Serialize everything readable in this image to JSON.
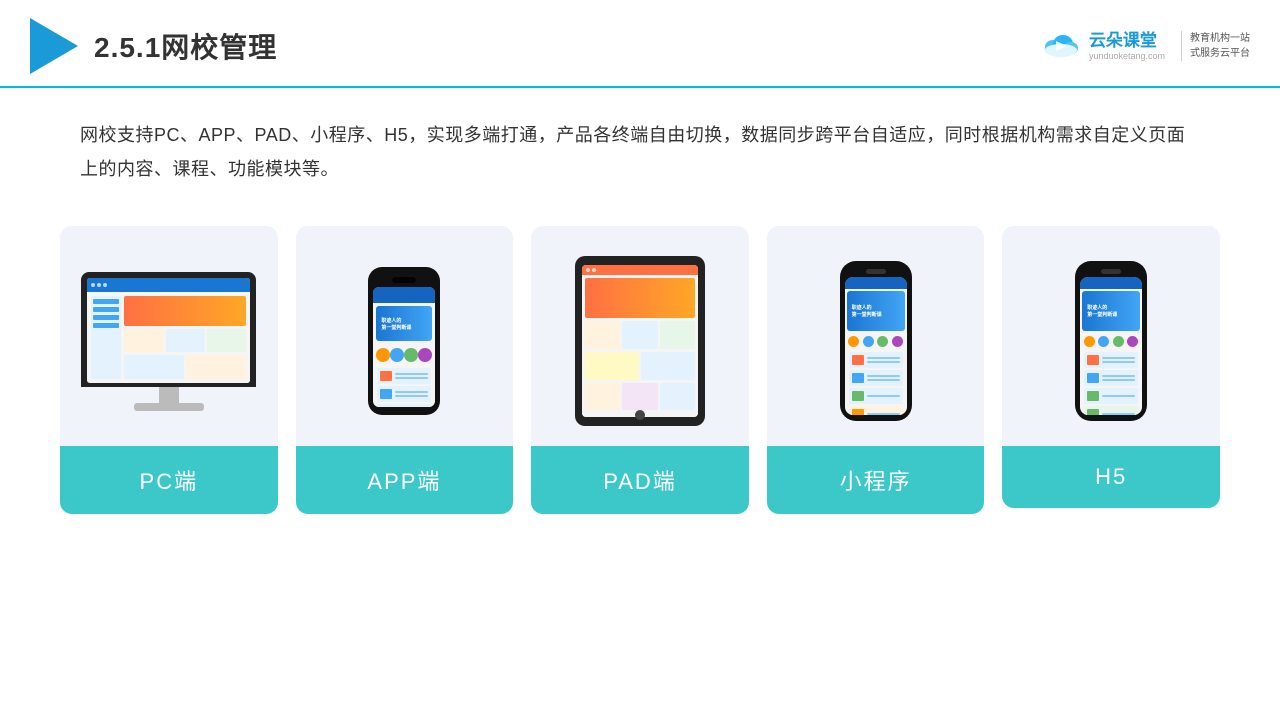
{
  "header": {
    "title": "2.5.1网校管理",
    "brand_name": "云朵课堂",
    "brand_url": "yunduoketang.com",
    "brand_slogan_line1": "教育机构一站",
    "brand_slogan_line2": "式服务云平台"
  },
  "description": {
    "text": "网校支持PC、APP、PAD、小程序、H5，实现多端打通，产品各终端自由切换，数据同步跨平台自适应，同时根据机构需求自定义页面上的内容、课程、功能模块等。"
  },
  "cards": [
    {
      "label": "PC端"
    },
    {
      "label": "APP端"
    },
    {
      "label": "PAD端"
    },
    {
      "label": "小程序"
    },
    {
      "label": "H5"
    }
  ]
}
